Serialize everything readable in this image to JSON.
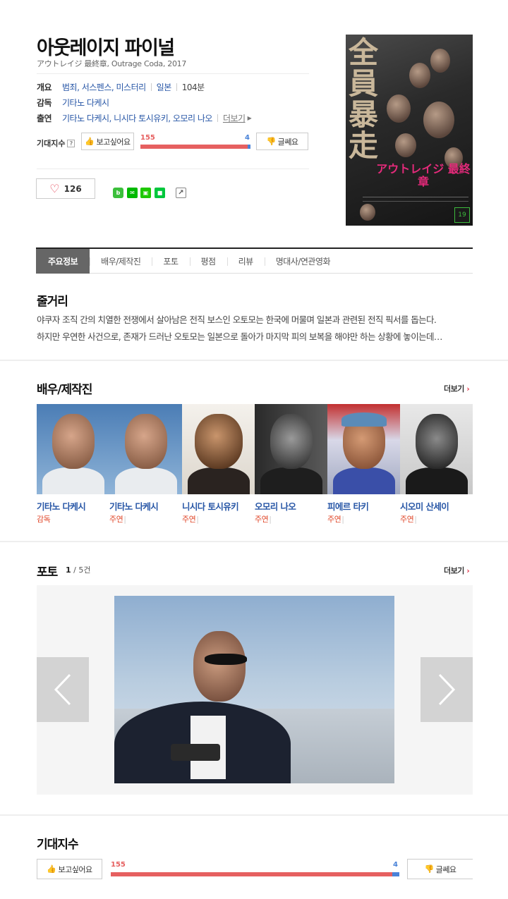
{
  "movie": {
    "title": "아웃레이지 파이널",
    "subtitle": "アウトレイジ 最終章, Outrage Coda, 2017"
  },
  "info": {
    "overview_label": "개요",
    "genres": "범죄, 서스펜스, 미스터리",
    "country": "일본",
    "runtime": "104분",
    "director_label": "감독",
    "director": "기타노 다케시",
    "cast_label": "출연",
    "cast": "기타노 다케시, 니시다 토시유키, 오모리 나오",
    "more": "더보기"
  },
  "expect": {
    "label": "기대지수",
    "help": "?",
    "want_label": "보고싶어요",
    "meh_label": "글쎄요",
    "want_count": "155",
    "meh_count": "4",
    "want_ratio": 0.975
  },
  "like": {
    "count": "126"
  },
  "share_icons": [
    "band-icon",
    "line-icon",
    "bookmark-icon",
    "memo-icon",
    "share-icon"
  ],
  "poster": {
    "kanji": "全員暴走",
    "title": "アウトレイジ 最終章",
    "rating": "19"
  },
  "tabs": [
    "주요정보",
    "배우/제작진",
    "포토",
    "평점",
    "리뷰",
    "명대사/연관영화"
  ],
  "synopsis": {
    "heading": "줄거리",
    "line1": "야쿠자 조직 간의 치열한 전쟁에서 살아남은 전직 보스인 오토모는 한국에 머물며 일본과 관련된 전직 픽서를 돕는다.",
    "line2": " 하지만 우연한 사건으로, 존재가 드러난 오토모는 일본으로 돌아가 마지막 피의 보복을 해야만 하는 상황에 놓이는데…"
  },
  "cast_section": {
    "heading": "배우/제작진",
    "more": "더보기",
    "members": [
      {
        "name": "기타노 다케시",
        "role": "감독",
        "role_color": "#e0482b"
      },
      {
        "name": "기타노 다케시",
        "role": "주연",
        "role_color": "#e0482b"
      },
      {
        "name": "니시다 토시유키",
        "role": "주연",
        "role_color": "#e0482b"
      },
      {
        "name": "오모리 나오",
        "role": "주연",
        "role_color": "#e0482b"
      },
      {
        "name": "피에르 타키",
        "role": "주연",
        "role_color": "#e0482b"
      },
      {
        "name": "시오미 산세이",
        "role": "주연",
        "role_color": "#e0482b"
      }
    ]
  },
  "photo_section": {
    "heading": "포토",
    "current": "1",
    "total": "5건",
    "more": "더보기"
  },
  "expect2": {
    "heading": "기대지수",
    "want_label": "보고싶어요",
    "meh_label": "글쎄요",
    "want_count": "155",
    "meh_count": "4"
  },
  "colors": {
    "link": "#2756a6",
    "want_bar": "#e66060",
    "meh_bar": "#4a83d8",
    "role": "#e0482b"
  }
}
